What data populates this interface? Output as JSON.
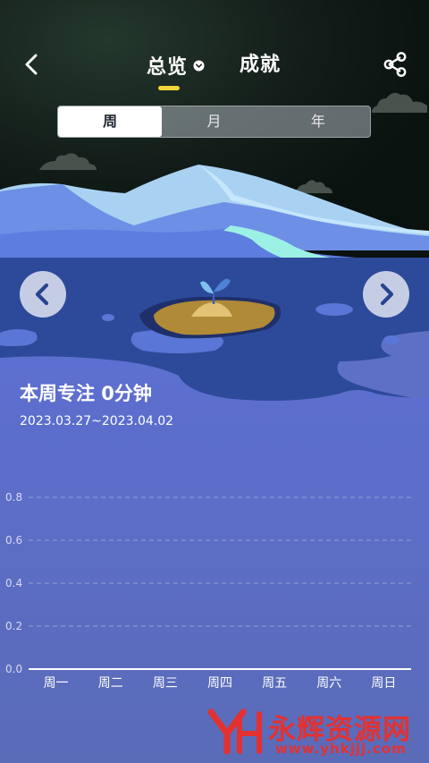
{
  "header": {
    "tabs": [
      {
        "label": "总览",
        "active": true
      },
      {
        "label": "成就",
        "active": false
      }
    ]
  },
  "period_selector": {
    "options": [
      "周",
      "月",
      "年"
    ],
    "selected": "周"
  },
  "summary": {
    "title": "本周专注 0分钟",
    "date_range": "2023.03.27~2023.04.02"
  },
  "chart_data": {
    "type": "bar",
    "categories": [
      "周一",
      "周二",
      "周三",
      "周四",
      "周五",
      "周六",
      "周日"
    ],
    "values": [
      0,
      0,
      0,
      0,
      0,
      0,
      0
    ],
    "y_ticks": [
      "0.0",
      "0.2",
      "0.4",
      "0.6",
      "0.8"
    ],
    "ylim": [
      0,
      0.8
    ],
    "grid": true
  },
  "icons": {
    "back": "chevron-left-icon",
    "share": "share-icon",
    "prev": "chevron-left-icon",
    "next": "chevron-right-icon",
    "moon": "crescent-moon-icon",
    "sprout": "sprout-icon"
  },
  "colors": {
    "accent": "#f1d43a",
    "night_sky": "#0f1a17",
    "water": "#5d70c6"
  },
  "watermark": {
    "text": "永辉资源网",
    "url": "www.yhkjjj.com"
  }
}
